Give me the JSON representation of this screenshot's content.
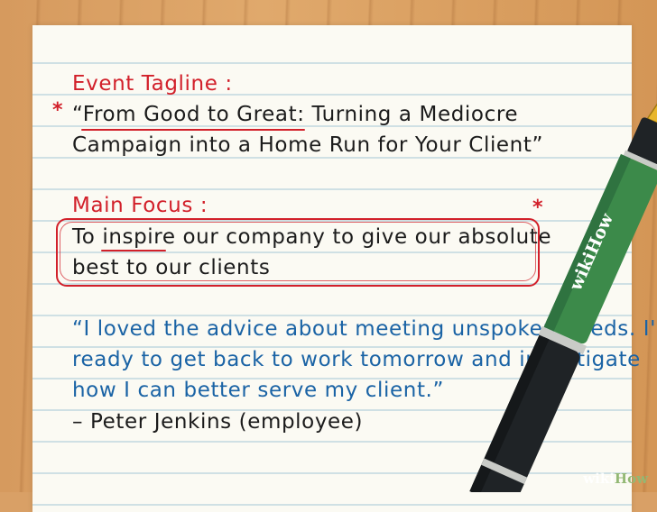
{
  "note": {
    "tagline_heading": "Event Tagline :",
    "tagline_line1": "“From Good to Great: Turning a Mediocre",
    "tagline_line2": "Campaign into a Home Run for Your Client”",
    "focus_heading": "Main Focus :",
    "focus_line1": "To inspire our company to give our absolute",
    "focus_line2": "best to our clients",
    "quote_line1": "“I loved the advice about meeting unspoken needs. I'm",
    "quote_line2": "ready to get back to work tomorrow and investigate",
    "quote_line3": "how I can better serve my client.”",
    "attribution": "– Peter Jenkins (employee)"
  },
  "pen": {
    "brand_text": "wikiHow"
  },
  "watermark": {
    "prefix": "wiki",
    "suffix": "How"
  },
  "colors": {
    "red_ink": "#d2202a",
    "black_ink": "#1b1b1b",
    "blue_ink": "#1a63a5",
    "pen_green": "#3c8a4a",
    "wood": "#d9a066"
  }
}
